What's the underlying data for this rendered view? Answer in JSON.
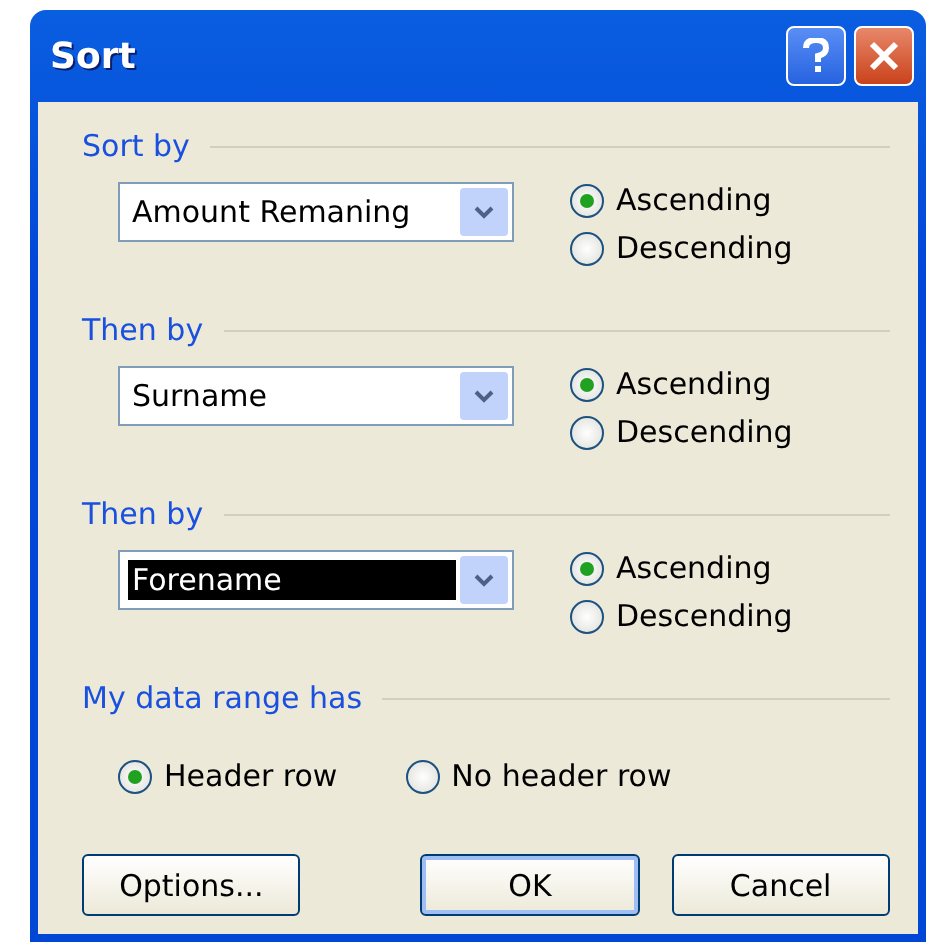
{
  "window": {
    "title": "Sort"
  },
  "sort_groups": [
    {
      "heading": "Sort by",
      "field": {
        "value": "Amount Remaning",
        "highlighted": false
      },
      "options": [
        {
          "label": "Ascending",
          "selected": true
        },
        {
          "label": "Descending",
          "selected": false
        }
      ]
    },
    {
      "heading": "Then by",
      "field": {
        "value": "Surname",
        "highlighted": false
      },
      "options": [
        {
          "label": "Ascending",
          "selected": true
        },
        {
          "label": "Descending",
          "selected": false
        }
      ]
    },
    {
      "heading": "Then by",
      "field": {
        "value": "Forename",
        "highlighted": true
      },
      "options": [
        {
          "label": "Ascending",
          "selected": true
        },
        {
          "label": "Descending",
          "selected": false
        }
      ]
    }
  ],
  "data_range": {
    "heading": "My data range has",
    "options": [
      {
        "label": "Header row",
        "selected": true
      },
      {
        "label": "No header row",
        "selected": false
      }
    ]
  },
  "buttons": [
    {
      "label": "Options...",
      "default": false
    },
    {
      "label": "OK",
      "default": true
    },
    {
      "label": "Cancel",
      "default": false
    }
  ]
}
